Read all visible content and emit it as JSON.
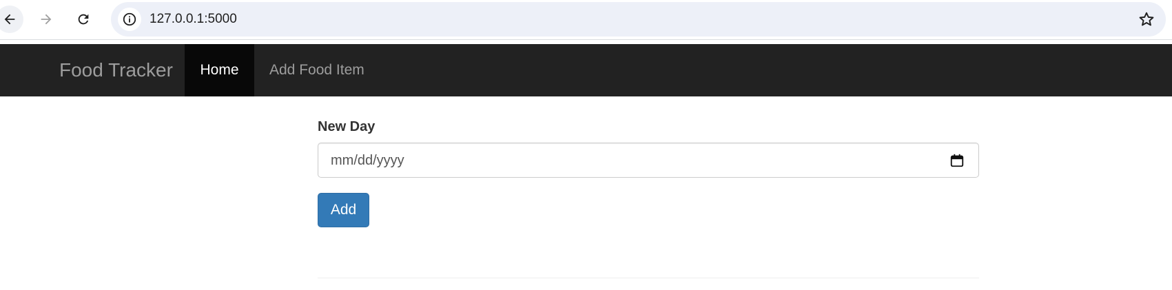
{
  "browser": {
    "url": "127.0.0.1:5000",
    "icons": {
      "back": "arrow-left-icon",
      "forward": "arrow-right-icon",
      "reload": "reload-icon",
      "site_info": "info-icon",
      "bookmark": "star-icon"
    }
  },
  "navbar": {
    "brand": "Food Tracker",
    "items": [
      {
        "label": "Home",
        "active": true
      },
      {
        "label": "Add Food Item",
        "active": false
      }
    ]
  },
  "form": {
    "label": "New Day",
    "date_placeholder": "mm/dd/yyyy",
    "submit_label": "Add"
  },
  "colors": {
    "navbar_bg": "#222222",
    "navbar_active_bg": "#080808",
    "navbar_text": "#9d9d9d",
    "primary_button": "#337ab7"
  }
}
